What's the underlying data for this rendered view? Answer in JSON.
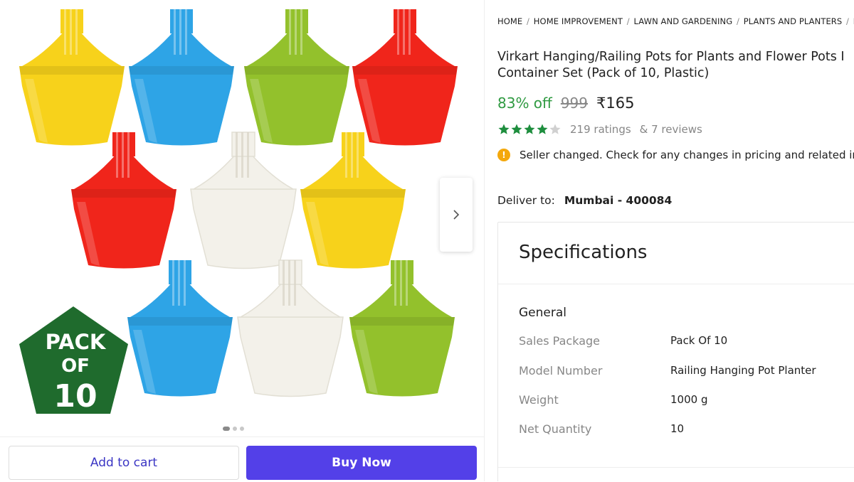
{
  "breadcrumb": [
    "HOME",
    "HOME IMPROVEMENT",
    "LAWN AND GARDENING",
    "PLANTS AND PLANTERS",
    "PL"
  ],
  "product": {
    "title_line1": "Virkart Hanging/Railing Pots for Plants and Flower Pots I",
    "title_line2": "Container Set (Pack of 10, Plastic)",
    "discount": "83% off",
    "mrp": "999",
    "price": "₹165",
    "rating_value": 4,
    "ratings_text": "219 ratings",
    "reviews_text": "& 7 reviews",
    "seller_notice": "Seller changed. Check for any changes in pricing and related info",
    "deliver_label": "Deliver to:",
    "deliver_location": "Mumbai - 400084"
  },
  "image": {
    "badge_line1": "PACK",
    "badge_line2": "OF",
    "badge_line3": "10",
    "pot_colors": [
      "#f7d21b",
      "#2ea4e6",
      "#93c12c",
      "#f0251b",
      "#f0251b",
      "#f3f1ea",
      "#f7d21b",
      "#2ea4e6",
      "#f3f1ea",
      "#93c12c"
    ],
    "badge_color": "#1f6b2d",
    "slide_count": 3,
    "active_slide": 1
  },
  "buttons": {
    "add_to_cart": "Add to cart",
    "buy_now": "Buy Now"
  },
  "specifications": {
    "title": "Specifications",
    "group": "General",
    "rows": [
      {
        "key": "Sales Package",
        "value": "Pack Of 10"
      },
      {
        "key": "Model Number",
        "value": "Railing Hanging Pot Planter"
      },
      {
        "key": "Weight",
        "value": "1000 g"
      },
      {
        "key": "Net Quantity",
        "value": "10"
      }
    ]
  },
  "colors": {
    "discount_green": "#2f9a41",
    "star_green": "#1e8e3e",
    "buy_button": "#5340e8",
    "notice_icon": "#f4a80c"
  },
  "icons": [
    "chevron-right-icon",
    "star-icon",
    "info-icon"
  ]
}
